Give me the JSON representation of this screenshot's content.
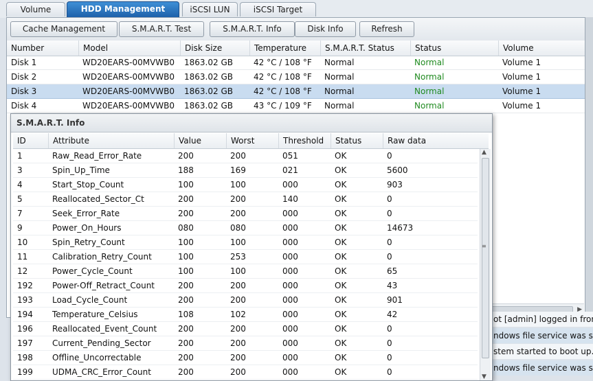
{
  "tabs": [
    {
      "label": "Volume"
    },
    {
      "label": "HDD Management"
    },
    {
      "label": "iSCSI LUN"
    },
    {
      "label": "iSCSI Target"
    }
  ],
  "toolbar": {
    "cache": "Cache Management",
    "smart_test": "S.M.A.R.T. Test",
    "smart_info": "S.M.A.R.T. Info",
    "disk_info": "Disk Info",
    "refresh": "Refresh"
  },
  "disk_grid": {
    "headers": [
      "Number",
      "Model",
      "Disk Size",
      "Temperature",
      "S.M.A.R.T. Status",
      "Status",
      "Volume"
    ],
    "rows": [
      [
        "Disk 1",
        "WD20EARS-00MVWB0",
        "1863.02 GB",
        "42 °C / 108 °F",
        "Normal",
        "Normal",
        "Volume 1"
      ],
      [
        "Disk 2",
        "WD20EARS-00MVWB0",
        "1863.02 GB",
        "42 °C / 108 °F",
        "Normal",
        "Normal",
        "Volume 1"
      ],
      [
        "Disk 3",
        "WD20EARS-00MVWB0",
        "1863.02 GB",
        "42 °C / 108 °F",
        "Normal",
        "Normal",
        "Volume 1"
      ],
      [
        "Disk 4",
        "WD20EARS-00MVWB0",
        "1863.02 GB",
        "43 °C / 109 °F",
        "Normal",
        "Normal",
        "Volume 1"
      ]
    ],
    "selected_row": 2,
    "status_color": "#1f8a1f",
    "selection_color": "#c9dcf0"
  },
  "log_fragments": [
    "ot [admin] logged in from",
    "ndows file service was star",
    "stem started to boot up.",
    "ndows file service was stop"
  ],
  "smart_dialog": {
    "title": "S.M.A.R.T. Info",
    "headers": [
      "ID",
      "Attribute",
      "Value",
      "Worst",
      "Threshold",
      "Status",
      "Raw data"
    ],
    "rows": [
      [
        "1",
        "Raw_Read_Error_Rate",
        "200",
        "200",
        "051",
        "OK",
        "0"
      ],
      [
        "3",
        "Spin_Up_Time",
        "188",
        "169",
        "021",
        "OK",
        "5600"
      ],
      [
        "4",
        "Start_Stop_Count",
        "100",
        "100",
        "000",
        "OK",
        "903"
      ],
      [
        "5",
        "Reallocated_Sector_Ct",
        "200",
        "200",
        "140",
        "OK",
        "0"
      ],
      [
        "7",
        "Seek_Error_Rate",
        "200",
        "200",
        "000",
        "OK",
        "0"
      ],
      [
        "9",
        "Power_On_Hours",
        "080",
        "080",
        "000",
        "OK",
        "14673"
      ],
      [
        "10",
        "Spin_Retry_Count",
        "100",
        "100",
        "000",
        "OK",
        "0"
      ],
      [
        "11",
        "Calibration_Retry_Count",
        "100",
        "253",
        "000",
        "OK",
        "0"
      ],
      [
        "12",
        "Power_Cycle_Count",
        "100",
        "100",
        "000",
        "OK",
        "65"
      ],
      [
        "192",
        "Power-Off_Retract_Count",
        "200",
        "200",
        "000",
        "OK",
        "43"
      ],
      [
        "193",
        "Load_Cycle_Count",
        "200",
        "200",
        "000",
        "OK",
        "901"
      ],
      [
        "194",
        "Temperature_Celsius",
        "108",
        "102",
        "000",
        "OK",
        "42"
      ],
      [
        "196",
        "Reallocated_Event_Count",
        "200",
        "200",
        "000",
        "OK",
        "0"
      ],
      [
        "197",
        "Current_Pending_Sector",
        "200",
        "200",
        "000",
        "OK",
        "0"
      ],
      [
        "198",
        "Offline_Uncorrectable",
        "200",
        "200",
        "000",
        "OK",
        "0"
      ],
      [
        "199",
        "UDMA_CRC_Error_Count",
        "200",
        "200",
        "000",
        "OK",
        "0"
      ]
    ]
  },
  "icons": {
    "scroll_up": "triangle-up-icon",
    "scroll_down": "triangle-down-icon",
    "scroll_right": "triangle-right-icon",
    "scroll_grip": "grip-icon"
  }
}
